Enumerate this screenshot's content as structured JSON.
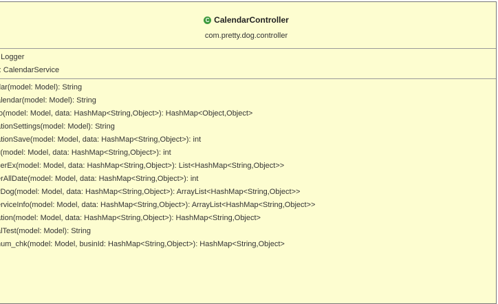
{
  "class_box": {
    "icon": "class-icon",
    "icon_glyph": "C",
    "class_name": "CalendarController",
    "package_name": "com.pretty.dog.controller"
  },
  "fields": [
    ": Logger",
    "r: CalendarService"
  ],
  "methods": [
    "dar(model: Model): String",
    "alendar(model: Model): String",
    "fo(model: Model, data: HashMap<String,Object>): HashMap<Object,Object>",
    "ationSettings(model: Model): String",
    "ationSave(model: Model, data: HashMap<String,Object>): int",
    "y(model: Model, data: HashMap<String,Object>): int",
    "serEx(model: Model, data: HashMap<String,Object>): List<HashMap<String,Object>>",
    "erAllDate(model: Model, data: HashMap<String,Object>): int",
    "vDog(model: Model, data: HashMap<String,Object>): ArrayList<HashMap<String,Object>>",
    "erviceInfo(model: Model, data: HashMap<String,Object>): ArrayList<HashMap<String,Object>>",
    "ation(model: Model, data: HashMap<String,Object>): HashMap<String,Object>",
    "alTest(model: Model): String",
    "num_chk(model: Model, businId: HashMap<String,Object>): HashMap<String,Object>"
  ]
}
